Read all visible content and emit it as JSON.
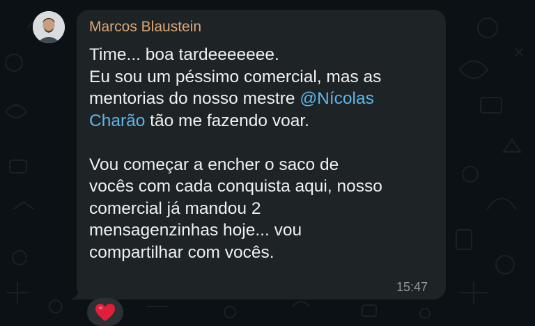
{
  "message": {
    "sender_name": "Marcos Blaustein",
    "lines_before_mention": [
      "Time... boa tardeeeeeee.",
      "Eu sou um péssimo comercial, mas as"
    ],
    "mention_line_prefix": "mentorias do nosso mestre ",
    "mention_part1": "@Nícolas",
    "mention_part2": "Charão",
    "mention_line_suffix": " tão me fazendo voar.",
    "paragraph2_lines": [
      "Vou começar a encher o saco de",
      "vocês com cada conquista aqui, nosso",
      "comercial já mandou 2",
      "mensagenzinhas hoje... vou",
      "compartilhar com vocês."
    ],
    "time": "15:47"
  },
  "reactions": [
    {
      "icon": "heart-icon",
      "color": "#e0203a"
    }
  ],
  "colors": {
    "background": "#0c1115",
    "bubble": "#1e2326",
    "sender_name": "#e0a874",
    "message_text": "#eef0f1",
    "mention": "#5fb6e8",
    "timestamp": "#93999c"
  }
}
